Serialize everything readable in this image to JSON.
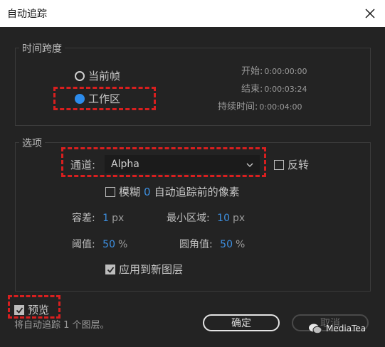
{
  "window": {
    "title": "自动追踪"
  },
  "time_span": {
    "group_title": "时间跨度",
    "options": [
      {
        "label": "当前帧",
        "selected": false
      },
      {
        "label": "工作区",
        "selected": true
      }
    ],
    "start_label": "开始:",
    "start_value": "0:00:00:00",
    "end_label": "结束:",
    "end_value": "0:00:03:24",
    "duration_label": "持续时间:",
    "duration_value": "0:00:04:00"
  },
  "options": {
    "group_title": "选项",
    "channel_label": "通道:",
    "channel_value": "Alpha",
    "invert_label": "反转",
    "blur_label_pre": "模糊",
    "blur_value": "0",
    "blur_label_post": "自动追踪前的像素",
    "tolerance_label": "容差:",
    "tolerance_value": "1",
    "tolerance_unit": "px",
    "min_area_label": "最小区域:",
    "min_area_value": "10",
    "min_area_unit": "px",
    "threshold_label": "阈值:",
    "threshold_value": "50",
    "threshold_unit": "%",
    "corner_label": "圆角值:",
    "corner_value": "50",
    "corner_unit": "%",
    "apply_new_layer_label": "应用到新图层"
  },
  "preview": {
    "label": "预览",
    "checked": true
  },
  "status_text": "将自动追踪 1 个图层。",
  "buttons": {
    "ok": "确定",
    "cancel": "取消"
  },
  "watermark": {
    "text": "MediaTea"
  },
  "colors": {
    "accent": "#2d8ceb",
    "highlight": "#d81f1f",
    "value_blue": "#3d8fe0"
  }
}
